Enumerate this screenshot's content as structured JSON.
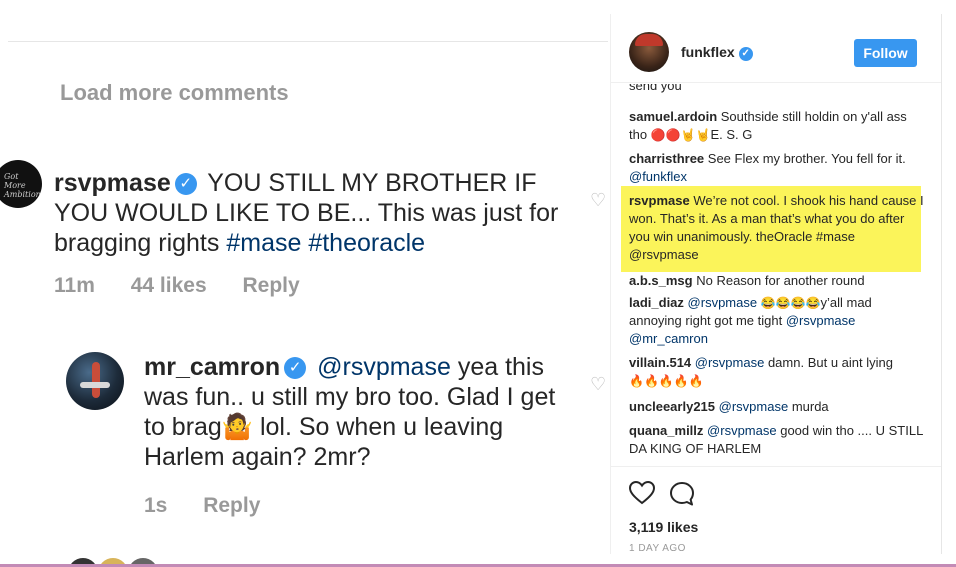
{
  "left": {
    "load_more": "Load more comments",
    "comment1": {
      "username": "rsvpmase",
      "text": "YOU STILL MY BROTHER IF YOU WOULD LIKE TO BE... This was just for bragging rights",
      "tags": "#mase #theoracle",
      "time": "11m",
      "likes": "44 likes",
      "reply": "Reply",
      "avatar_text": "Got More Ambition"
    },
    "comment2": {
      "username": "mr_camron",
      "mention": "@rsvpmase",
      "text_a": "yea this was fun.. u still my bro too. Glad I get to brag",
      "emoji": "🤷",
      "text_b": "lol. So when u leaving Harlem again? 2mr?",
      "time": "1s",
      "reply": "Reply"
    }
  },
  "right": {
    "header": {
      "username": "funkflex",
      "follow_label": "Follow"
    },
    "cut_text": "send you",
    "comments": [
      {
        "user": "samuel.ardoin",
        "text": "Southside still holdin on y'all ass tho",
        "emoji": "🔴🔴🤘🤘",
        "tail": "E. S. G"
      },
      {
        "user": "charristhree",
        "text": "See Flex my brother. You fell for it.",
        "mention": "@funkflex"
      },
      {
        "user": "rsvpmase",
        "text": "We’re not cool. I shook his hand cause I won. That’s it. As a man that’s what you do after you win unanimously. theOracle #mase @rsvpmase"
      },
      {
        "user": "a.b.s_msg",
        "text": "No Reason for another round"
      },
      {
        "user": "ladi_diaz",
        "mention": "@rsvpmase",
        "emoji": "😂😂😂😂",
        "text": "y’all mad annoying right got me tight",
        "mention2": "@rsvpmase",
        "mention3": "@mr_camron"
      },
      {
        "user": "villain.514",
        "mention": "@rsvpmase",
        "text": "damn. But u aint lying",
        "emoji": "🔥🔥🔥🔥🔥"
      },
      {
        "user": "uncleearly215",
        "mention": "@rsvpmase",
        "text": "murda"
      },
      {
        "user": "quana_millz",
        "mention": "@rsvpmase",
        "text": "good win tho .... U STILL DA KING OF HARLEM"
      }
    ],
    "likes": "3,119 likes",
    "ago": "1 DAY AGO"
  },
  "colors": {
    "accent": "#3897f0",
    "highlight": "#fbf45a",
    "link": "#003569",
    "muted": "#999999"
  },
  "icons": [
    "heart-icon",
    "comment-icon",
    "verified-icon"
  ]
}
